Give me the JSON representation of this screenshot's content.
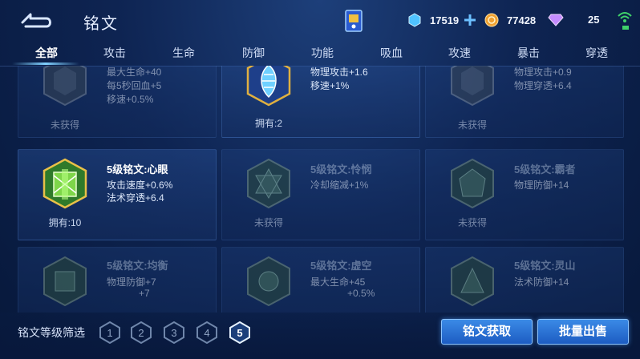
{
  "header": {
    "title": "铭文"
  },
  "currencies": [
    {
      "icon": "coupon-gem-icon",
      "amount": "17519",
      "color": "#4fc3ff"
    },
    {
      "icon": "gold-coin-icon",
      "amount": "77428",
      "color": "#f0a030"
    },
    {
      "icon": "diamond-icon",
      "amount": "25",
      "color": "#c48cff"
    }
  ],
  "tabs": [
    "全部",
    "攻击",
    "生命",
    "防御",
    "功能",
    "吸血",
    "攻速",
    "暴击",
    "穿透"
  ],
  "active_tab": "全部",
  "cards": [
    {
      "name": "",
      "attrs": [
        "最大生命+40",
        "每5秒回血+5",
        "移速+0.5%"
      ],
      "owned": "未获得",
      "emblem": "gray"
    },
    {
      "name": "",
      "attrs": [
        "物理攻击+1.6",
        "移速+1%"
      ],
      "owned": "拥有:2",
      "emblem": "blue"
    },
    {
      "name": "",
      "attrs": [
        "物理攻击+0.9",
        "物理穿透+6.4"
      ],
      "owned": "未获得",
      "emblem": "gray"
    },
    {
      "name": "5级铭文:心眼",
      "attrs": [
        "攻击速度+0.6%",
        "法术穿透+6.4"
      ],
      "owned": "拥有:10",
      "emblem": "green"
    },
    {
      "name": "5级铭文:怜悯",
      "attrs": [
        "冷却缩减+1%"
      ],
      "owned": "未获得",
      "emblem": "gray"
    },
    {
      "name": "5级铭文:霸者",
      "attrs": [
        "物理防御+14"
      ],
      "owned": "未获得",
      "emblem": "gray"
    },
    {
      "name": "5级铭文:均衡",
      "attrs": [
        "物理防御+7",
        "+7"
      ],
      "owned": "",
      "emblem": "gray"
    },
    {
      "name": "5级铭文:虚空",
      "attrs": [
        "最大生命+45",
        "+0.5%"
      ],
      "owned": "",
      "emblem": "gray"
    },
    {
      "name": "5级铭文:灵山",
      "attrs": [
        "法术防御+14"
      ],
      "owned": "",
      "emblem": "gray"
    }
  ],
  "footer": {
    "filter_label": "铭文等级筛选",
    "levels": [
      "1",
      "2",
      "3",
      "4",
      "5"
    ],
    "selected_level": "5",
    "obtain_button": "铭文获取",
    "bulk_sell_button": "批量出售"
  }
}
